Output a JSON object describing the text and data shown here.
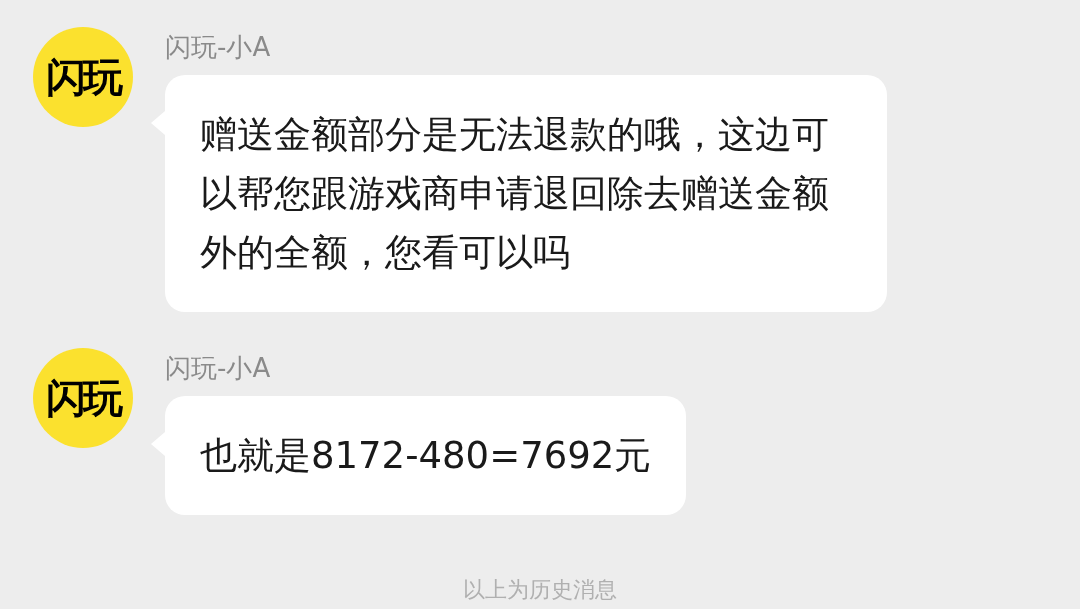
{
  "messages": [
    {
      "avatar": "闪玩",
      "sender": "闪玩-小A",
      "text": "赠送金额部分是无法退款的哦，这边可以帮您跟游戏商申请退回除去赠送金额外的全额，您看可以吗"
    },
    {
      "avatar": "闪玩",
      "sender": "闪玩-小A",
      "text": "也就是8172-480=7692元"
    }
  ],
  "footer": "以上为历史消息"
}
